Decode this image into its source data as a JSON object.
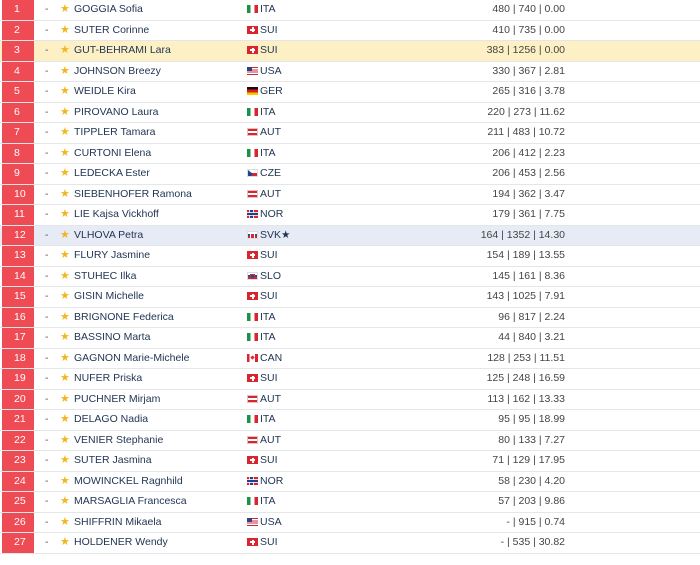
{
  "rows": [
    {
      "rank": "1",
      "move": "-",
      "name": "GOGGIA Sofia",
      "nation": "ITA",
      "flag": "ita",
      "stats": "480 | 740 | 0.00",
      "highlight": ""
    },
    {
      "rank": "2",
      "move": "-",
      "name": "SUTER Corinne",
      "nation": "SUI",
      "flag": "sui",
      "stats": "410 | 735 | 0.00",
      "highlight": ""
    },
    {
      "rank": "3",
      "move": "-",
      "name": "GUT-BEHRAMI Lara",
      "nation": "SUI",
      "flag": "sui",
      "stats": "383 | 1256 | 0.00",
      "highlight": "yellow"
    },
    {
      "rank": "4",
      "move": "-",
      "name": "JOHNSON Breezy",
      "nation": "USA",
      "flag": "usa",
      "stats": "330 | 367 | 2.81",
      "highlight": ""
    },
    {
      "rank": "5",
      "move": "-",
      "name": "WEIDLE Kira",
      "nation": "GER",
      "flag": "ger",
      "stats": "265 | 316 | 3.78",
      "highlight": ""
    },
    {
      "rank": "6",
      "move": "-",
      "name": "PIROVANO Laura",
      "nation": "ITA",
      "flag": "ita",
      "stats": "220 | 273 | 11.62",
      "highlight": ""
    },
    {
      "rank": "7",
      "move": "-",
      "name": "TIPPLER Tamara",
      "nation": "AUT",
      "flag": "aut",
      "stats": "211 | 483 | 10.72",
      "highlight": ""
    },
    {
      "rank": "8",
      "move": "-",
      "name": "CURTONI Elena",
      "nation": "ITA",
      "flag": "ita",
      "stats": "206 | 412 | 2.23",
      "highlight": ""
    },
    {
      "rank": "9",
      "move": "-",
      "name": "LEDECKA Ester",
      "nation": "CZE",
      "flag": "cze",
      "stats": "206 | 453 | 2.56",
      "highlight": ""
    },
    {
      "rank": "10",
      "move": "-",
      "name": "SIEBENHOFER Ramona",
      "nation": "AUT",
      "flag": "aut",
      "stats": "194 | 362 | 3.47",
      "highlight": ""
    },
    {
      "rank": "11",
      "move": "-",
      "name": "LIE Kajsa Vickhoff",
      "nation": "NOR",
      "flag": "nor",
      "stats": "179 | 361 | 7.75",
      "highlight": ""
    },
    {
      "rank": "12",
      "move": "-",
      "name": "VLHOVA Petra",
      "nation": "SVK★",
      "flag": "svk",
      "stats": "164 | 1352 | 14.30",
      "highlight": "blue"
    },
    {
      "rank": "13",
      "move": "-",
      "name": "FLURY Jasmine",
      "nation": "SUI",
      "flag": "sui",
      "stats": "154 | 189 | 13.55",
      "highlight": ""
    },
    {
      "rank": "14",
      "move": "-",
      "name": "STUHEC Ilka",
      "nation": "SLO",
      "flag": "slo",
      "stats": "145 | 161 | 8.36",
      "highlight": ""
    },
    {
      "rank": "15",
      "move": "-",
      "name": "GISIN Michelle",
      "nation": "SUI",
      "flag": "sui",
      "stats": "143 | 1025 | 7.91",
      "highlight": ""
    },
    {
      "rank": "16",
      "move": "-",
      "name": "BRIGNONE Federica",
      "nation": "ITA",
      "flag": "ita",
      "stats": "96 | 817 | 2.24",
      "highlight": ""
    },
    {
      "rank": "17",
      "move": "-",
      "name": "BASSINO Marta",
      "nation": "ITA",
      "flag": "ita",
      "stats": "44 | 840 | 3.21",
      "highlight": ""
    },
    {
      "rank": "18",
      "move": "-",
      "name": "GAGNON Marie-Michele",
      "nation": "CAN",
      "flag": "can",
      "stats": "128 | 253 | 11.51",
      "highlight": ""
    },
    {
      "rank": "19",
      "move": "-",
      "name": "NUFER Priska",
      "nation": "SUI",
      "flag": "sui",
      "stats": "125 | 248 | 16.59",
      "highlight": ""
    },
    {
      "rank": "20",
      "move": "-",
      "name": "PUCHNER Mirjam",
      "nation": "AUT",
      "flag": "aut",
      "stats": "113 | 162 | 13.33",
      "highlight": ""
    },
    {
      "rank": "21",
      "move": "-",
      "name": "DELAGO Nadia",
      "nation": "ITA",
      "flag": "ita",
      "stats": "95 | 95 | 18.99",
      "highlight": ""
    },
    {
      "rank": "22",
      "move": "-",
      "name": "VENIER Stephanie",
      "nation": "AUT",
      "flag": "aut",
      "stats": "80 | 133 | 7.27",
      "highlight": ""
    },
    {
      "rank": "23",
      "move": "-",
      "name": "SUTER Jasmina",
      "nation": "SUI",
      "flag": "sui",
      "stats": "71 | 129 | 17.95",
      "highlight": ""
    },
    {
      "rank": "24",
      "move": "-",
      "name": "MOWINCKEL Ragnhild",
      "nation": "NOR",
      "flag": "nor",
      "stats": "58 | 230 | 4.20",
      "highlight": ""
    },
    {
      "rank": "25",
      "move": "-",
      "name": "MARSAGLIA Francesca",
      "nation": "ITA",
      "flag": "ita",
      "stats": "57 | 203 | 9.86",
      "highlight": ""
    },
    {
      "rank": "26",
      "move": "-",
      "name": "SHIFFRIN Mikaela",
      "nation": "USA",
      "flag": "usa",
      "stats": "- | 915 | 0.74",
      "highlight": ""
    },
    {
      "rank": "27",
      "move": "-",
      "name": "HOLDENER Wendy",
      "nation": "SUI",
      "flag": "sui",
      "stats": "- | 535 | 30.82",
      "highlight": ""
    }
  ],
  "colors": {
    "rank_badge": "#ee4b55",
    "star": "#f3b51d",
    "highlight_yellow": "#fdf0c4",
    "highlight_blue": "#e6ebf6"
  },
  "icons": {
    "favorite": "star-icon"
  }
}
